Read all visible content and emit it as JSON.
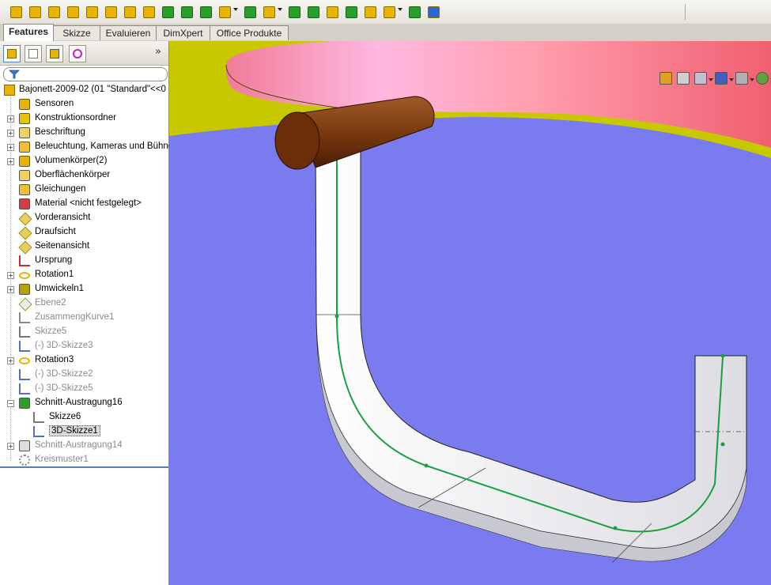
{
  "toolbar": {
    "buttons": [
      {
        "icon": "sketch-icon",
        "color": "#e8b400"
      },
      {
        "icon": "extrude-icon",
        "color": "#e8b400"
      },
      {
        "icon": "revolve-icon",
        "color": "#e8b400"
      },
      {
        "icon": "sweep-icon",
        "color": "#e8b400"
      },
      {
        "icon": "loft-icon",
        "color": "#e8b400"
      },
      {
        "icon": "boundary-icon",
        "color": "#e8b400"
      },
      {
        "icon": "cut-extrude-icon",
        "color": "#e8b400"
      },
      {
        "icon": "cut-revolve-icon",
        "color": "#e8b400"
      },
      {
        "icon": "cut-sweep-icon",
        "color": "#2aa02a"
      },
      {
        "icon": "cut-loft-icon",
        "color": "#2aa02a"
      },
      {
        "icon": "cut-boundary-icon",
        "color": "#2aa02a"
      },
      {
        "icon": "fillet-icon",
        "color": "#e8b400"
      },
      {
        "icon": "linear-pattern-icon",
        "color": "#2aa02a"
      },
      {
        "icon": "rib-icon",
        "color": "#e8b400"
      },
      {
        "icon": "draft-icon",
        "color": "#2aa02a"
      },
      {
        "icon": "shell-icon",
        "color": "#2aa02a"
      },
      {
        "icon": "wrap-icon",
        "color": "#e8b400"
      },
      {
        "icon": "dome-icon",
        "color": "#2aa02a"
      },
      {
        "icon": "mirror-icon",
        "color": "#e8b400"
      },
      {
        "icon": "reference-geometry-icon",
        "color": "#e8b400"
      },
      {
        "icon": "curves-icon",
        "color": "#2aa02a"
      },
      {
        "icon": "instant3d-icon",
        "color": "#2a6ad0"
      }
    ]
  },
  "tabs": [
    {
      "label": "Features",
      "active": true
    },
    {
      "label": "Skizze",
      "active": false
    },
    {
      "label": "Evaluieren",
      "active": false
    },
    {
      "label": "DimXpert",
      "active": false
    },
    {
      "label": "Office Produkte",
      "active": false
    }
  ],
  "panel": {
    "tabs": [
      "feature-manager-icon",
      "property-manager-icon",
      "configuration-manager-icon",
      "dimxpert-manager-icon"
    ],
    "expand_glyph": "»"
  },
  "tree": {
    "root": {
      "label": "Bajonett-2009-02  (01 \"Standard\"<<0",
      "icon": "part-icon"
    },
    "items": [
      {
        "label": "Sensoren",
        "icon": "sensor-icon",
        "expander": false,
        "dim": false,
        "selected": false,
        "indent": 0
      },
      {
        "label": "Konstruktionsordner",
        "icon": "design-binder-icon",
        "expander": true,
        "dim": false,
        "selected": false,
        "indent": 0
      },
      {
        "label": "Beschriftung",
        "icon": "annotations-icon",
        "expander": true,
        "dim": false,
        "selected": false,
        "indent": 0
      },
      {
        "label": "Beleuchtung, Kameras und Bühne",
        "icon": "lights-icon",
        "expander": true,
        "dim": false,
        "selected": false,
        "indent": 0
      },
      {
        "label": "Volumenkörper(2)",
        "icon": "solid-bodies-icon",
        "expander": true,
        "dim": false,
        "selected": false,
        "indent": 0
      },
      {
        "label": "Oberflächenkörper",
        "icon": "surface-bodies-icon",
        "expander": false,
        "dim": false,
        "selected": false,
        "indent": 0
      },
      {
        "label": "Gleichungen",
        "icon": "equations-icon",
        "expander": false,
        "dim": false,
        "selected": false,
        "indent": 0
      },
      {
        "label": "Material <nicht festgelegt>",
        "icon": "material-icon",
        "expander": false,
        "dim": false,
        "selected": false,
        "indent": 0
      },
      {
        "label": "Vorderansicht",
        "icon": "plane-icon",
        "expander": false,
        "dim": false,
        "selected": false,
        "indent": 0
      },
      {
        "label": "Draufsicht",
        "icon": "plane-icon",
        "expander": false,
        "dim": false,
        "selected": false,
        "indent": 0
      },
      {
        "label": "Seitenansicht",
        "icon": "plane-icon",
        "expander": false,
        "dim": false,
        "selected": false,
        "indent": 0
      },
      {
        "label": "Ursprung",
        "icon": "origin-icon",
        "expander": false,
        "dim": false,
        "selected": false,
        "indent": 0
      },
      {
        "label": "Rotation1",
        "icon": "revolve-icon",
        "expander": true,
        "dim": false,
        "selected": false,
        "indent": 0
      },
      {
        "label": "Umwickeln1",
        "icon": "wrap-icon",
        "expander": true,
        "dim": false,
        "selected": false,
        "indent": 0
      },
      {
        "label": "Ebene2",
        "icon": "plane-icon",
        "expander": false,
        "dim": true,
        "selected": false,
        "indent": 0
      },
      {
        "label": "ZusammengKurve1",
        "icon": "composite-curve-icon",
        "expander": false,
        "dim": true,
        "selected": false,
        "indent": 0
      },
      {
        "label": "Skizze5",
        "icon": "sketch-icon",
        "expander": false,
        "dim": true,
        "selected": false,
        "indent": 0
      },
      {
        "label": "(-) 3D-Skizze3",
        "icon": "3d-sketch-icon",
        "expander": false,
        "dim": true,
        "selected": false,
        "indent": 0
      },
      {
        "label": "Rotation3",
        "icon": "revolve-icon",
        "expander": true,
        "dim": false,
        "selected": false,
        "indent": 0
      },
      {
        "label": "(-) 3D-Skizze2",
        "icon": "3d-sketch-icon",
        "expander": false,
        "dim": true,
        "selected": false,
        "indent": 0
      },
      {
        "label": "(-) 3D-Skizze5",
        "icon": "3d-sketch-icon",
        "expander": false,
        "dim": true,
        "selected": false,
        "indent": 0
      },
      {
        "label": "Schnitt-Austragung16",
        "icon": "cut-sweep-icon",
        "expander": true,
        "dim": false,
        "selected": false,
        "indent": 0,
        "expanded": true
      },
      {
        "label": "Skizze6",
        "icon": "sketch-icon",
        "expander": false,
        "dim": false,
        "selected": false,
        "indent": 1
      },
      {
        "label": "3D-Skizze1",
        "icon": "3d-sketch-icon",
        "expander": false,
        "dim": false,
        "selected": true,
        "indent": 1
      },
      {
        "label": "Schnitt-Austragung14",
        "icon": "cut-sweep-icon",
        "expander": true,
        "dim": true,
        "selected": false,
        "indent": 0
      },
      {
        "label": "Kreismuster1",
        "icon": "circular-pattern-icon",
        "expander": false,
        "dim": true,
        "selected": false,
        "indent": 0
      }
    ]
  },
  "view_tools": [
    "zoom-to-fit-icon",
    "zoom-area-icon",
    "previous-view-icon",
    "section-view-icon",
    "view-orientation-icon",
    "display-style-icon",
    "hide-show-icon",
    "appearance-icon",
    "scene-icon"
  ],
  "colors": {
    "viewport_bg": "#7b7bf0",
    "top_face": "#c8c800",
    "pink_face": "#ff8fa0",
    "slot": "#f4f4f6",
    "pin": "#7a3a10",
    "path": "#18a040"
  }
}
